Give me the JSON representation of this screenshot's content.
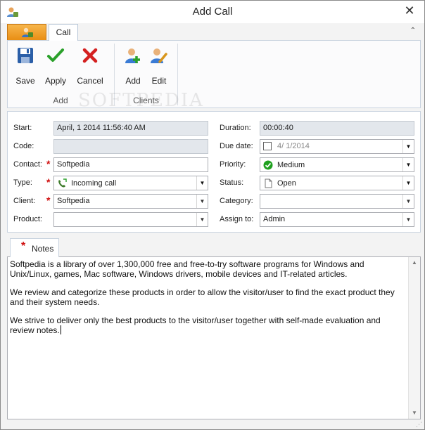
{
  "window": {
    "title": "Add Call",
    "close_glyph": "✕"
  },
  "tabs": {
    "app_tab_icon": "app-menu-icon",
    "call_tab": "Call",
    "collapse_glyph": "⌃"
  },
  "ribbon": {
    "groups": [
      {
        "label": "Add",
        "buttons": [
          {
            "label": "Save",
            "icon": "save-icon"
          },
          {
            "label": "Apply",
            "icon": "check-icon"
          },
          {
            "label": "Cancel",
            "icon": "cancel-icon"
          }
        ]
      },
      {
        "label": "Clients",
        "buttons": [
          {
            "label": "Add",
            "icon": "add-user-icon"
          },
          {
            "label": "Edit",
            "icon": "edit-user-icon"
          }
        ]
      }
    ],
    "watermark": "SOFTPEDIA"
  },
  "form": {
    "start": {
      "label": "Start:",
      "value": "April, 1 2014 11:56:40 AM"
    },
    "duration": {
      "label": "Duration:",
      "value": "00:00:40"
    },
    "code": {
      "label": "Code:",
      "value": ""
    },
    "due_date": {
      "label": "Due date:",
      "value": "4/  1/2014"
    },
    "contact": {
      "label": "Contact:",
      "value": "Softpedia"
    },
    "priority": {
      "label": "Priority:",
      "value": "Medium"
    },
    "type": {
      "label": "Type:",
      "value": "Incoming call"
    },
    "status": {
      "label": "Status:",
      "value": "Open"
    },
    "client": {
      "label": "Client:",
      "value": "Softpedia"
    },
    "category": {
      "label": "Category:",
      "value": ""
    },
    "product": {
      "label": "Product:",
      "value": ""
    },
    "assign_to": {
      "label": "Assign to:",
      "value": "Admin"
    },
    "required_marker": "*",
    "dropdown_glyph": "▼"
  },
  "notes": {
    "tab_label": "Notes",
    "required_marker": "*",
    "paragraphs": [
      "Softpedia is a library of over 1,300,000 free and free-to-try software programs for Windows and Unix/Linux, games, Mac software, Windows drivers, mobile devices and IT-related articles.",
      "We review and categorize these products in order to allow the visitor/user to find the exact product they and their system needs.",
      "We strive to deliver only the best products to the visitor/user together with self-made evaluation and review notes."
    ],
    "scroll_up_glyph": "▲",
    "scroll_down_glyph": "▼"
  },
  "colors": {
    "accent_tab": "#f0a030",
    "required": "#d01010",
    "readonly_field": "#e3e7ec"
  }
}
